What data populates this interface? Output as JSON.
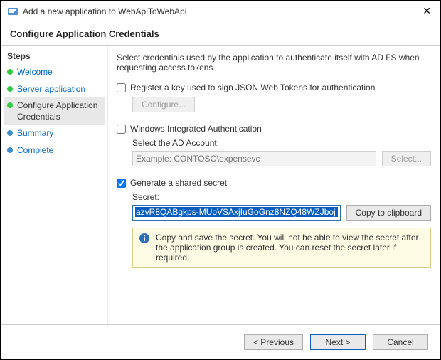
{
  "window": {
    "title": "Add a new application to WebApiToWebApi"
  },
  "header": {
    "title": "Configure Application Credentials"
  },
  "sidebar": {
    "title": "Steps",
    "items": [
      {
        "label": "Welcome"
      },
      {
        "label": "Server application"
      },
      {
        "label": "Configure Application Credentials"
      },
      {
        "label": "Summary"
      },
      {
        "label": "Complete"
      }
    ]
  },
  "main": {
    "intro": "Select credentials used by the application to authenticate itself with AD FS when requesting access tokens.",
    "register": {
      "label": "Register a key used to sign JSON Web Tokens for authentication",
      "configure_btn": "Configure..."
    },
    "wia": {
      "label": "Windows Integrated Authentication",
      "ad_label": "Select the AD Account:",
      "placeholder": "Example: CONTOSO\\expensevc",
      "select_btn": "Select..."
    },
    "secret": {
      "label": "Generate a shared secret",
      "field_label": "Secret:",
      "value": "azvR8QABgkps-MUoVSAxjIuGoGnz8NZQ48WZJboj",
      "copy_btn": "Copy to clipboard",
      "info": "Copy and save the secret.  You will not be able to view the secret after the application group is created.  You can reset the secret later if required."
    }
  },
  "footer": {
    "previous": "< Previous",
    "next": "Next >",
    "cancel": "Cancel"
  }
}
